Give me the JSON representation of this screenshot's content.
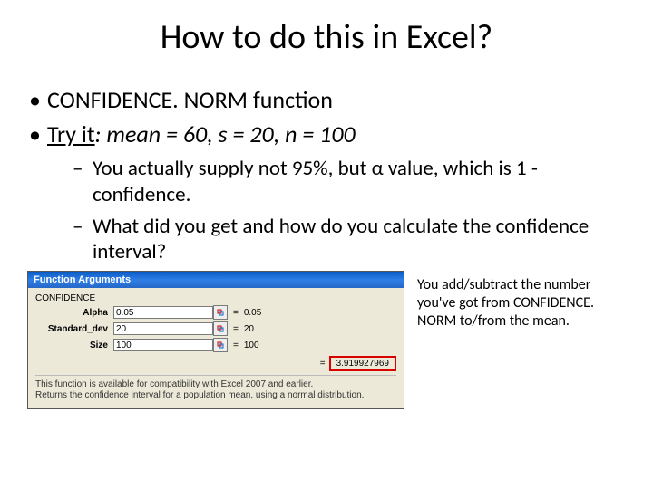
{
  "title": "How to do this in Excel?",
  "bullets": {
    "b1": "CONFIDENCE. NORM function",
    "b2_prefix": "Try it",
    "b2_rest": ": mean = 60, s = 20, n = 100"
  },
  "sub": {
    "s1": "You actually supply not 95%, but α value, which is 1 - confidence.",
    "s2": "What did you get and how do you calculate the confidence interval?"
  },
  "dialog": {
    "title": "Function Arguments",
    "group": "CONFIDENCE",
    "fields": {
      "alpha": {
        "label": "Alpha",
        "value": "0.05",
        "result": "0.05"
      },
      "stddev": {
        "label": "Standard_dev",
        "value": "20",
        "result": "20"
      },
      "size": {
        "label": "Size",
        "value": "100",
        "result": "100"
      }
    },
    "equals": "=",
    "final_result": "3.919927969",
    "description1": "This function is available for compatibility with Excel 2007 and earlier.",
    "description2": "Returns the confidence interval for a population mean, using a normal distribution."
  },
  "note": "You add/subtract the number you've got from CONFIDENCE. NORM to/from the mean."
}
